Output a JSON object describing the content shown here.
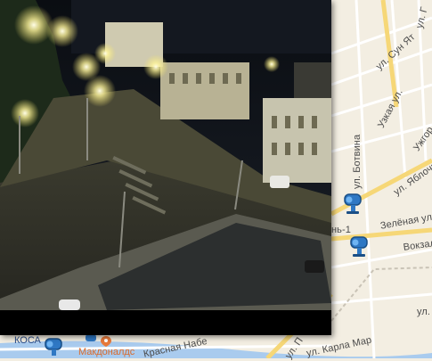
{
  "map": {
    "streets": {
      "sun_yat_sen": "ул. Сун Ят",
      "uzkaya": "Узкая ул.",
      "botvina": "ул. Ботвина",
      "yablochkova": "ул. Яблочк",
      "zelenaya": "Зелёная ул.",
      "vokzalnaya": "Вокзал",
      "krasnaya_nab": "Красная Набе",
      "karla_marksa": "ул. Карла Мар",
      "ul_p": "ул. П",
      "ul_right": "ул.",
      "ul_g": "ул. Г",
      "uzhgor": "Ужгор",
      "station_fragment": "нь-1"
    },
    "places": {
      "mcdonalds": "Макдоналдс",
      "kosa": "КОСА"
    },
    "colors": {
      "background": "#f3eee2",
      "road": "#ffffff",
      "main_road": "#f6d777",
      "water": "#a9cbee",
      "camera_marker": "#2f78c4"
    },
    "icons": [
      "camera-marker-icon",
      "location-pin-icon"
    ]
  },
  "webcam": {
    "alt": "Ночной вид перекрёстка с веб-камеры"
  }
}
